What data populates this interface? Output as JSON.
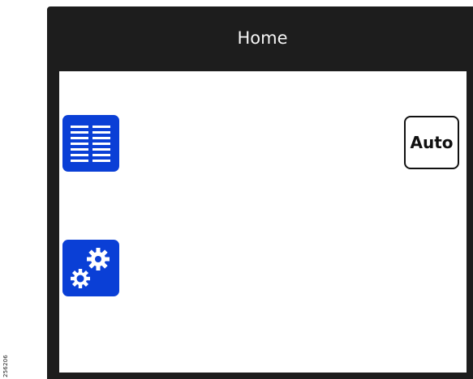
{
  "figure_code": "256206",
  "header": {
    "title": "Home"
  },
  "buttons": {
    "auto_label": "Auto"
  },
  "icons": {
    "list": "list-icon",
    "settings": "gears-icon"
  },
  "colors": {
    "tile_blue": "#0a3fd6",
    "frame": "#1d1d1d"
  }
}
